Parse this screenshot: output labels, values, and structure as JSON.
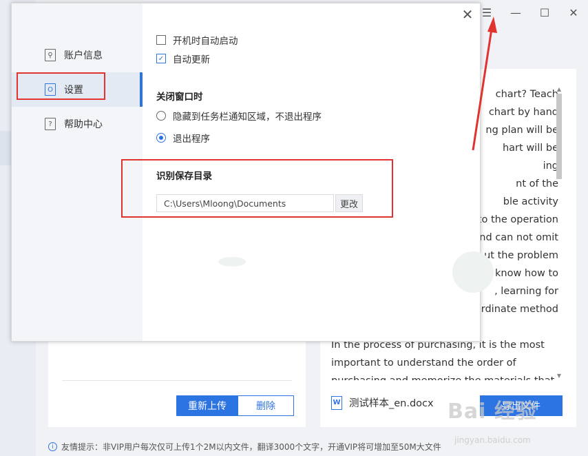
{
  "window": {
    "controls": [
      "☰",
      "—",
      "☐",
      "✕"
    ]
  },
  "dialog": {
    "nav": [
      {
        "label": "账户信息",
        "icon": "user-icon"
      },
      {
        "label": "设置",
        "icon": "settings-icon"
      },
      {
        "label": "帮助中心",
        "icon": "help-icon"
      }
    ],
    "active_nav": 1,
    "startup_option": {
      "label": "开机时自动启动",
      "checked": false
    },
    "update_option": {
      "label": "自动更新",
      "checked": true
    },
    "close_section_title": "关闭窗口时",
    "close_options": [
      {
        "label": "隐藏到任务栏通知区域，不退出程序",
        "selected": false
      },
      {
        "label": "退出程序",
        "selected": true
      }
    ],
    "save_dir_title": "识别保存目录",
    "save_dir_value": "C:\\Users\\Mloong\\Documents",
    "change_button": "更改"
  },
  "upload_panel": {
    "reupload_button": "重新上传",
    "delete_button": "删除"
  },
  "preview": {
    "lines_right": [
      "chart? Teach",
      "chart by hand",
      "ng plan will be",
      "hart will be",
      "ing",
      "nt of the",
      "ble activity",
      "to the operation",
      "nd can not omit",
      "ut the problem",
      "t know how to",
      ", learning for",
      "rdinate method"
    ],
    "lines_full": [
      "In the process of purchasing, it is the most",
      "important to understand the order of",
      "purchasing and memorize the materials that"
    ],
    "file_name": "测试样本_en.docx",
    "export_button": "导出文件"
  },
  "tip": "友情提示：非VIP用户每次仅可上传1个2M以内文件，翻译3000个文字，开通VIP将可增加至50M大文件",
  "watermark": {
    "main": "Bai 经验",
    "sub": "jingyan.baidu.com"
  },
  "colors": {
    "accent": "#2d74e3",
    "annotation": "#e0322f"
  }
}
